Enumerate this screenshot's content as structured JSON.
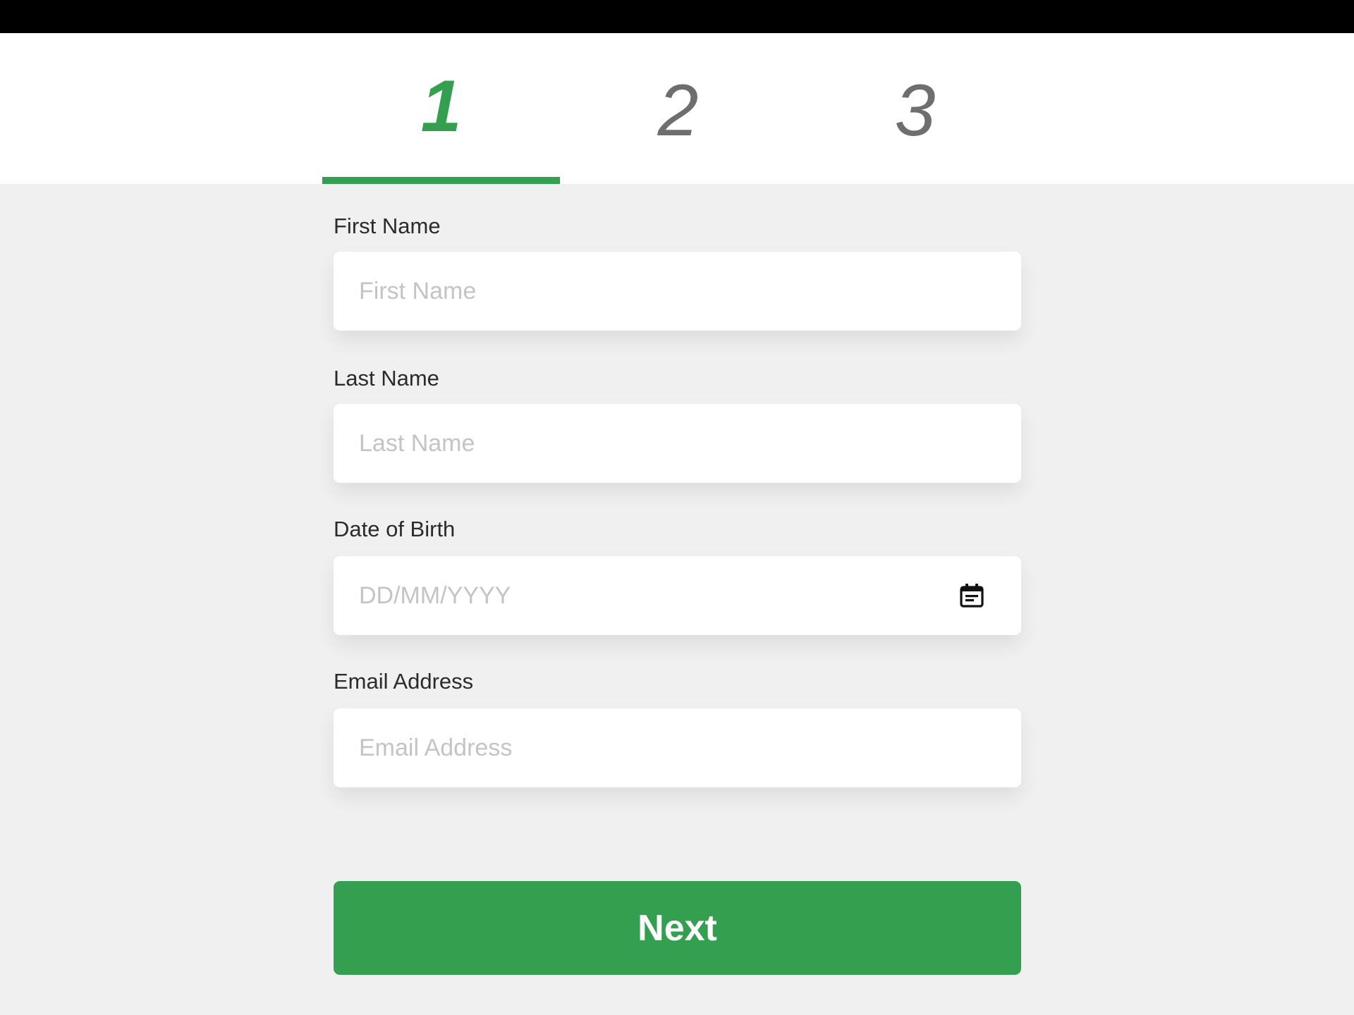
{
  "colors": {
    "accent": "#34a04f",
    "inactive_step": "#6e6e6e",
    "background": "#f0f0f0",
    "top_bar": "#000000"
  },
  "stepper": {
    "steps": [
      {
        "label": "1",
        "active": true
      },
      {
        "label": "2",
        "active": false
      },
      {
        "label": "3",
        "active": false
      }
    ]
  },
  "form": {
    "first_name": {
      "label": "First Name",
      "placeholder": "First Name",
      "value": ""
    },
    "last_name": {
      "label": "Last Name",
      "placeholder": "Last Name",
      "value": ""
    },
    "dob": {
      "label": "Date of Birth",
      "placeholder": "DD/MM/YYYY",
      "value": "",
      "icon": "calendar-icon"
    },
    "email": {
      "label": "Email Address",
      "placeholder": "Email Address",
      "value": ""
    }
  },
  "actions": {
    "next_label": "Next"
  }
}
